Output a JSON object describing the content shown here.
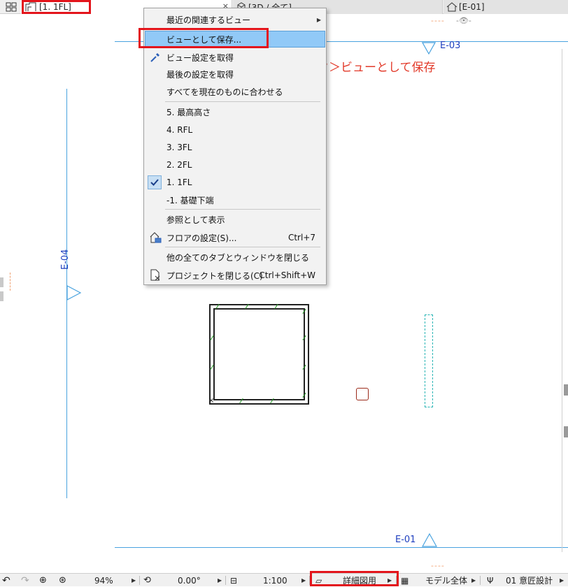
{
  "tabs": {
    "plan": {
      "label": "[1. 1FL]",
      "close": "×"
    },
    "view3d": {
      "label": "[3D / 全て]"
    },
    "elevation": {
      "label": "[E-01]"
    }
  },
  "canvas": {
    "elevation_labels": {
      "top": "E-03",
      "left": "E-04",
      "bottom": "E-01"
    },
    "marker_dashes": "----",
    "annotation": "右クリック＞ビューとして保存"
  },
  "context_menu": {
    "items": [
      {
        "label": "最近の関連するビュー",
        "submenu": true
      },
      {
        "label": "ビューとして保存...",
        "selected": true
      },
      {
        "label": "ビュー設定を取得",
        "icon": "eyedropper-icon"
      },
      {
        "label": "最後の設定を取得"
      },
      {
        "label": "すべてを現在のものに合わせる"
      },
      {
        "label": "5. 最高高さ"
      },
      {
        "label": "4. RFL"
      },
      {
        "label": "3. 3FL"
      },
      {
        "label": "2. 2FL"
      },
      {
        "label": "1. 1FL",
        "checked": true
      },
      {
        "label": "-1. 基礎下端"
      },
      {
        "label": "参照として表示"
      },
      {
        "label": "フロアの設定(S)...",
        "shortcut": "Ctrl+7",
        "icon": "floor-settings-icon"
      },
      {
        "label": "他の全てのタブとウィンドウを閉じる"
      },
      {
        "label": "プロジェクトを閉じる(C)",
        "shortcut": "Ctrl+Shift+W",
        "icon": "close-project-icon"
      }
    ]
  },
  "statusbar": {
    "zoom": "94%",
    "angle": "0.00°",
    "scale": "1:100",
    "layer_combo": "詳細図用",
    "model_view": "モデル全体",
    "pen_set": "01 意匠設計"
  },
  "colors": {
    "highlight": "#e3151c",
    "menu_selection": "#91c9f7",
    "elevation_line": "#4aa3df",
    "elevation_text": "#1f3fbf",
    "annotation_text": "#e23a2a"
  }
}
